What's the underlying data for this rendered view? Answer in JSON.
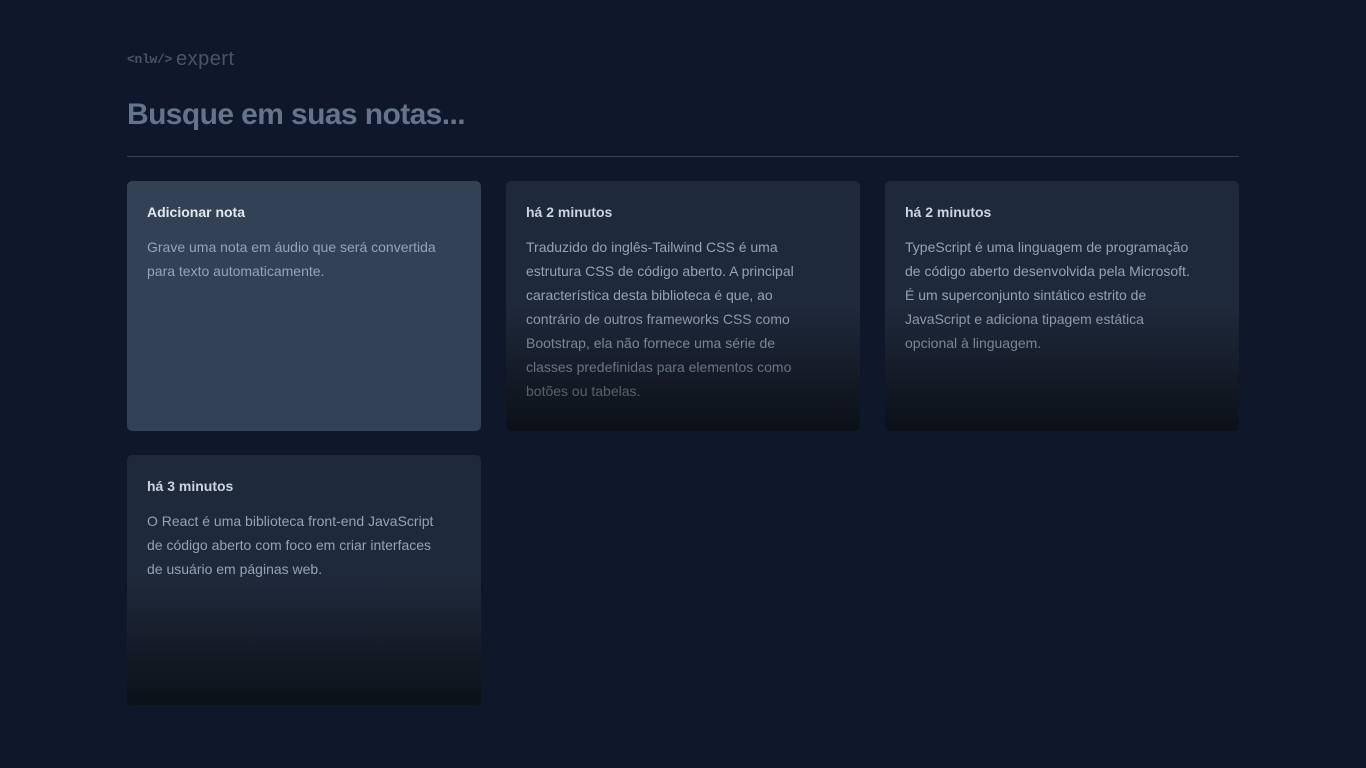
{
  "logo": {
    "tag": "<nlw/>",
    "word": "expert"
  },
  "search": {
    "placeholder": "Busque em suas notas..."
  },
  "add_card": {
    "title": "Adicionar nota",
    "text": "Grave uma nota em áudio que será convertida\npara texto automaticamente."
  },
  "notes": [
    {
      "date": "há 2 minutos",
      "content": "Traduzido do inglês-Tailwind CSS é uma\nestrutura CSS de código aberto. A principal\ncaracterística desta biblioteca é que, ao\ncontrário de outros frameworks CSS como\nBootstrap, ela não fornece uma série de\nclasses predefinidas para elementos como\nbotões ou tabelas."
    },
    {
      "date": "há 2 minutos",
      "content": "TypeScript é uma linguagem de programação\nde código aberto desenvolvida pela Microsoft.\nÉ um superconjunto sintático estrito de\nJavaScript e adiciona tipagem estática\nopcional à linguagem."
    },
    {
      "date": "há 3 minutos",
      "content": "O React é uma biblioteca front-end JavaScript\nde código aberto com foco em criar interfaces\nde usuário em páginas web."
    }
  ]
}
